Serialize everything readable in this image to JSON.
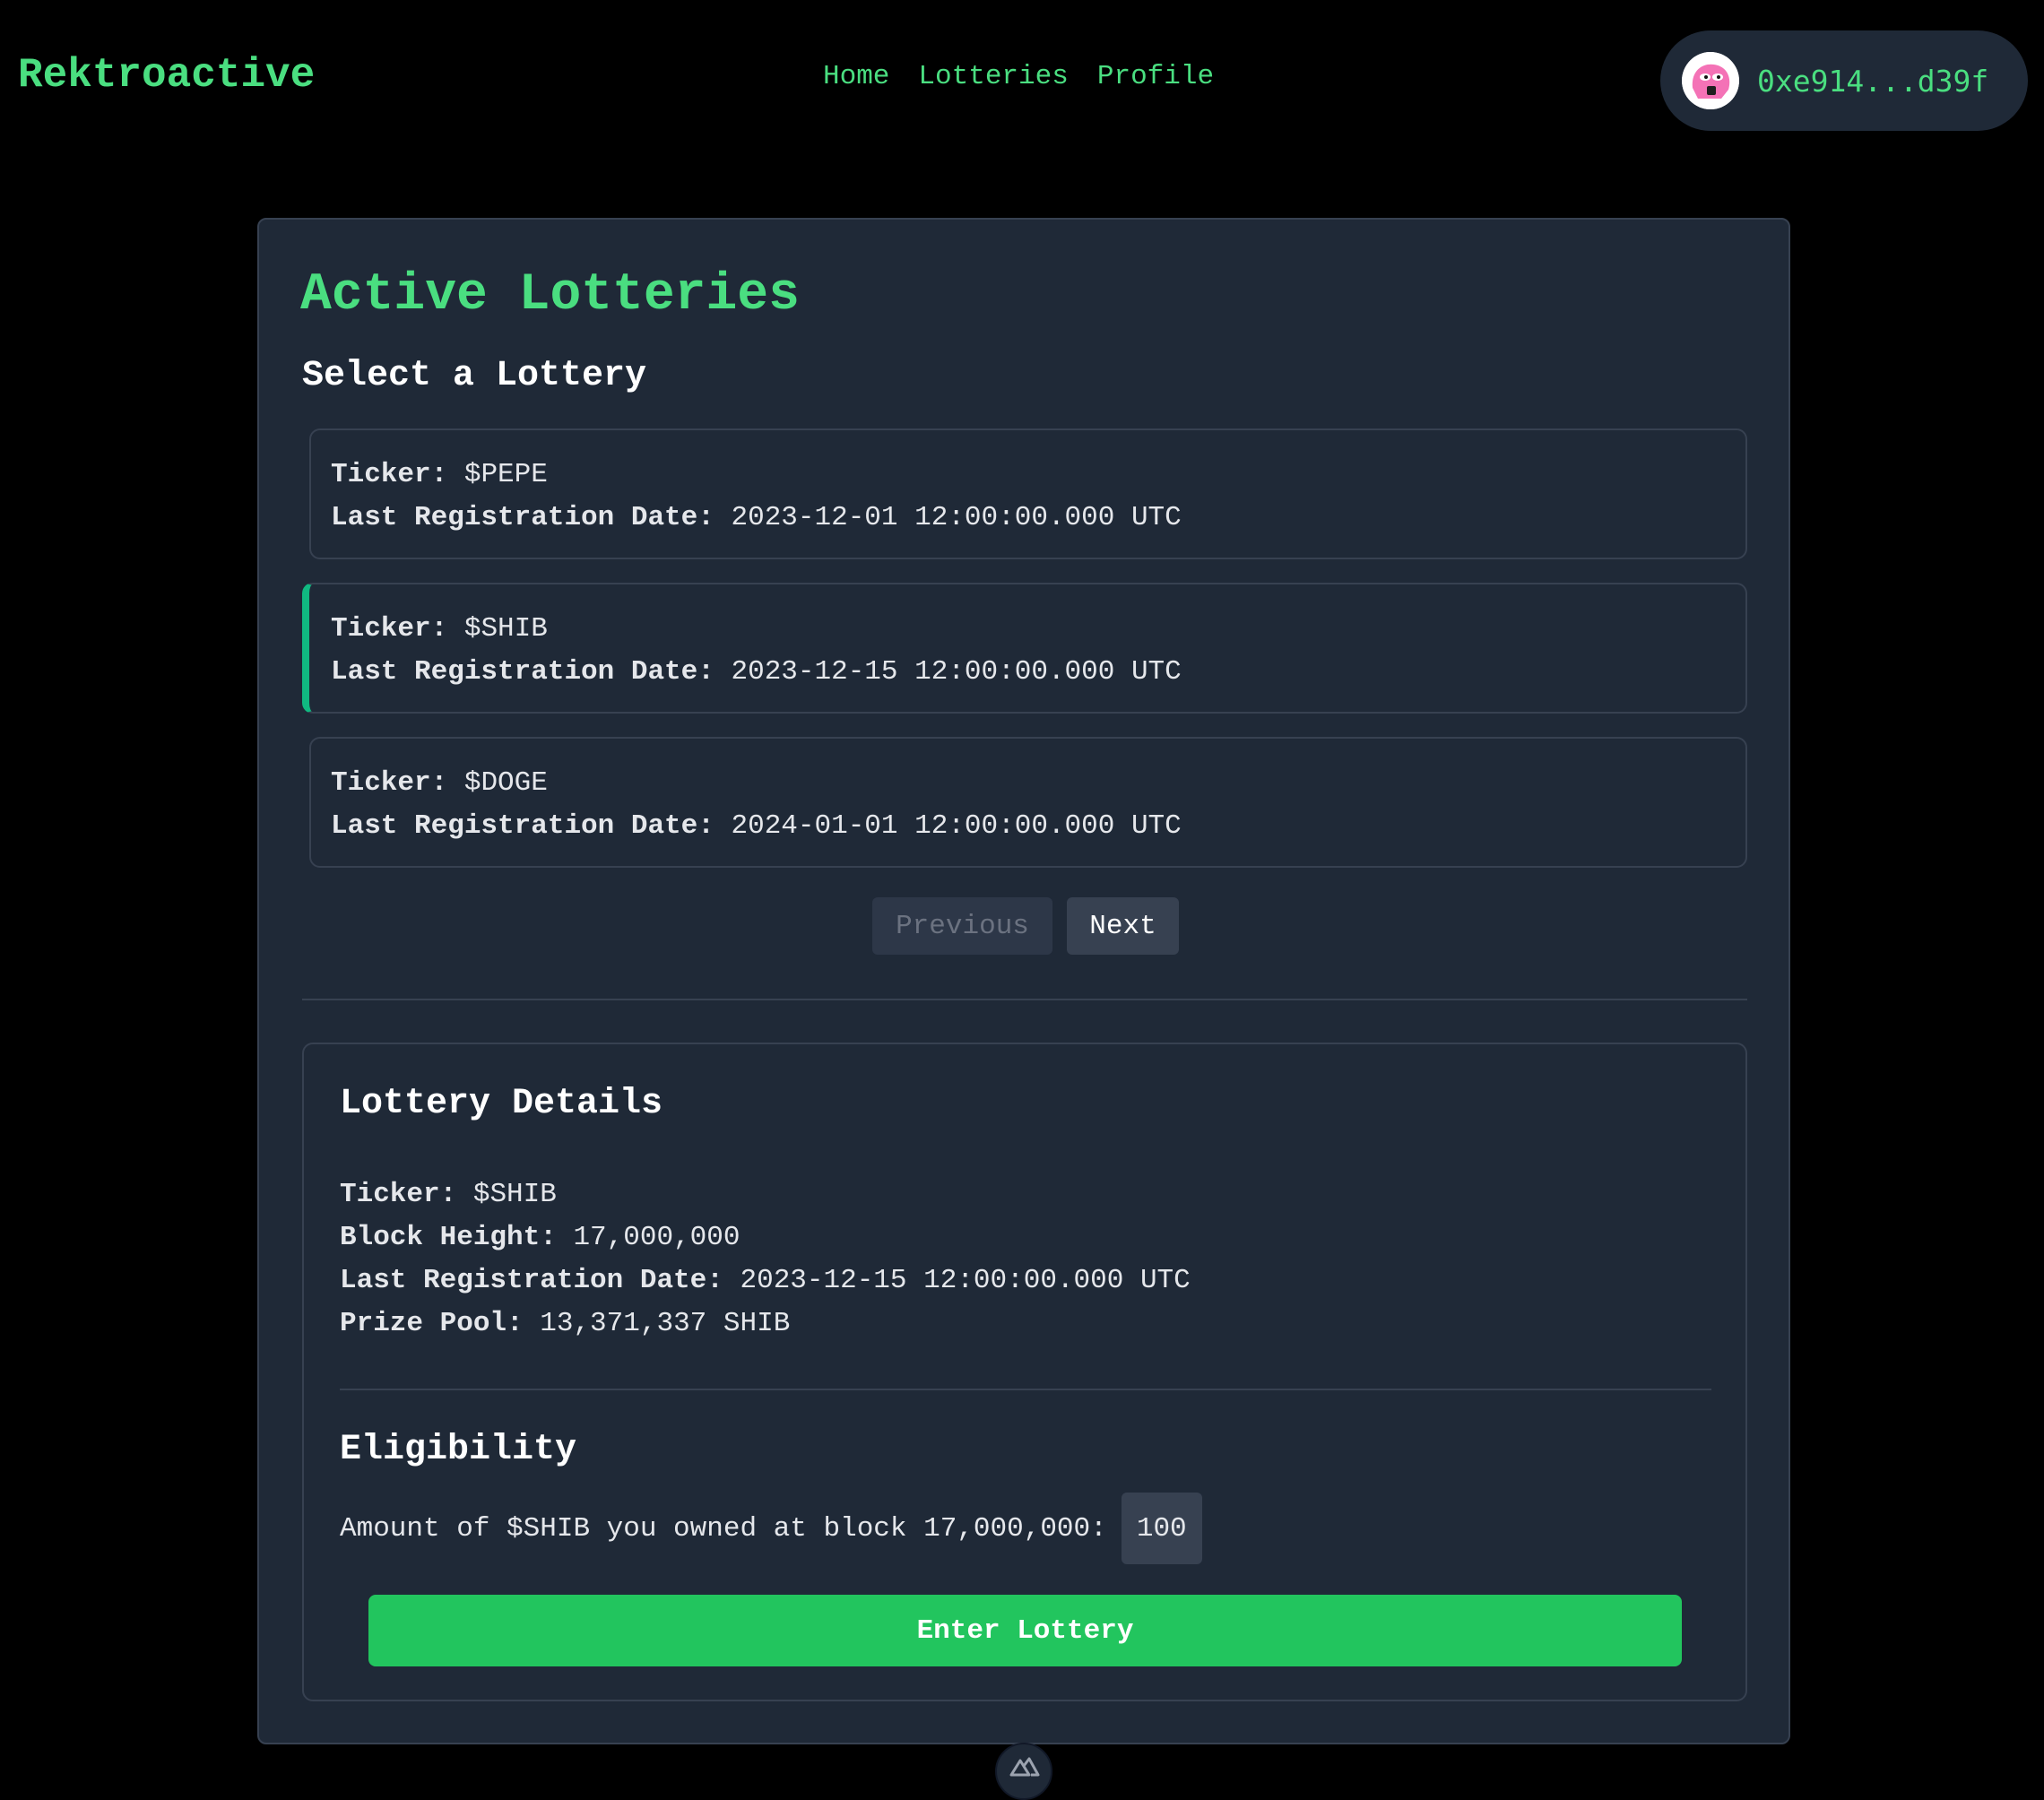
{
  "header": {
    "logo": "Rektroactive",
    "nav": [
      "Home",
      "Lotteries",
      "Profile"
    ],
    "wallet_address": "0xe914...d39f",
    "avatar_icon": "pepe-avatar-icon"
  },
  "main": {
    "title": "Active Lotteries",
    "select_title": "Select a Lottery",
    "ticker_label": "Ticker:",
    "date_label": "Last Registration Date:",
    "lotteries": [
      {
        "ticker": "$PEPE",
        "date": "2023-12-01 12:00:00.000 UTC",
        "selected": false
      },
      {
        "ticker": "$SHIB",
        "date": "2023-12-15 12:00:00.000 UTC",
        "selected": true
      },
      {
        "ticker": "$DOGE",
        "date": "2024-01-01 12:00:00.000 UTC",
        "selected": false
      }
    ],
    "pager": {
      "previous": "Previous",
      "next": "Next"
    }
  },
  "details": {
    "title": "Lottery Details",
    "ticker_label": "Ticker:",
    "ticker": "$SHIB",
    "block_label": "Block Height:",
    "block": "17,000,000",
    "date_label": "Last Registration Date:",
    "date": "2023-12-15 12:00:00.000 UTC",
    "prize_label": "Prize Pool:",
    "prize": "13,371,337 SHIB",
    "eligibility_title": "Eligibility",
    "eligibility_text": "Amount of $SHIB you owned at block 17,000,000:",
    "eligibility_value": "100",
    "enter_button": "Enter Lottery"
  },
  "colors": {
    "accent": "#4ade80",
    "button": "#22c55e",
    "selected_border": "#10b981",
    "card": "#1f2937",
    "background": "#000000"
  }
}
